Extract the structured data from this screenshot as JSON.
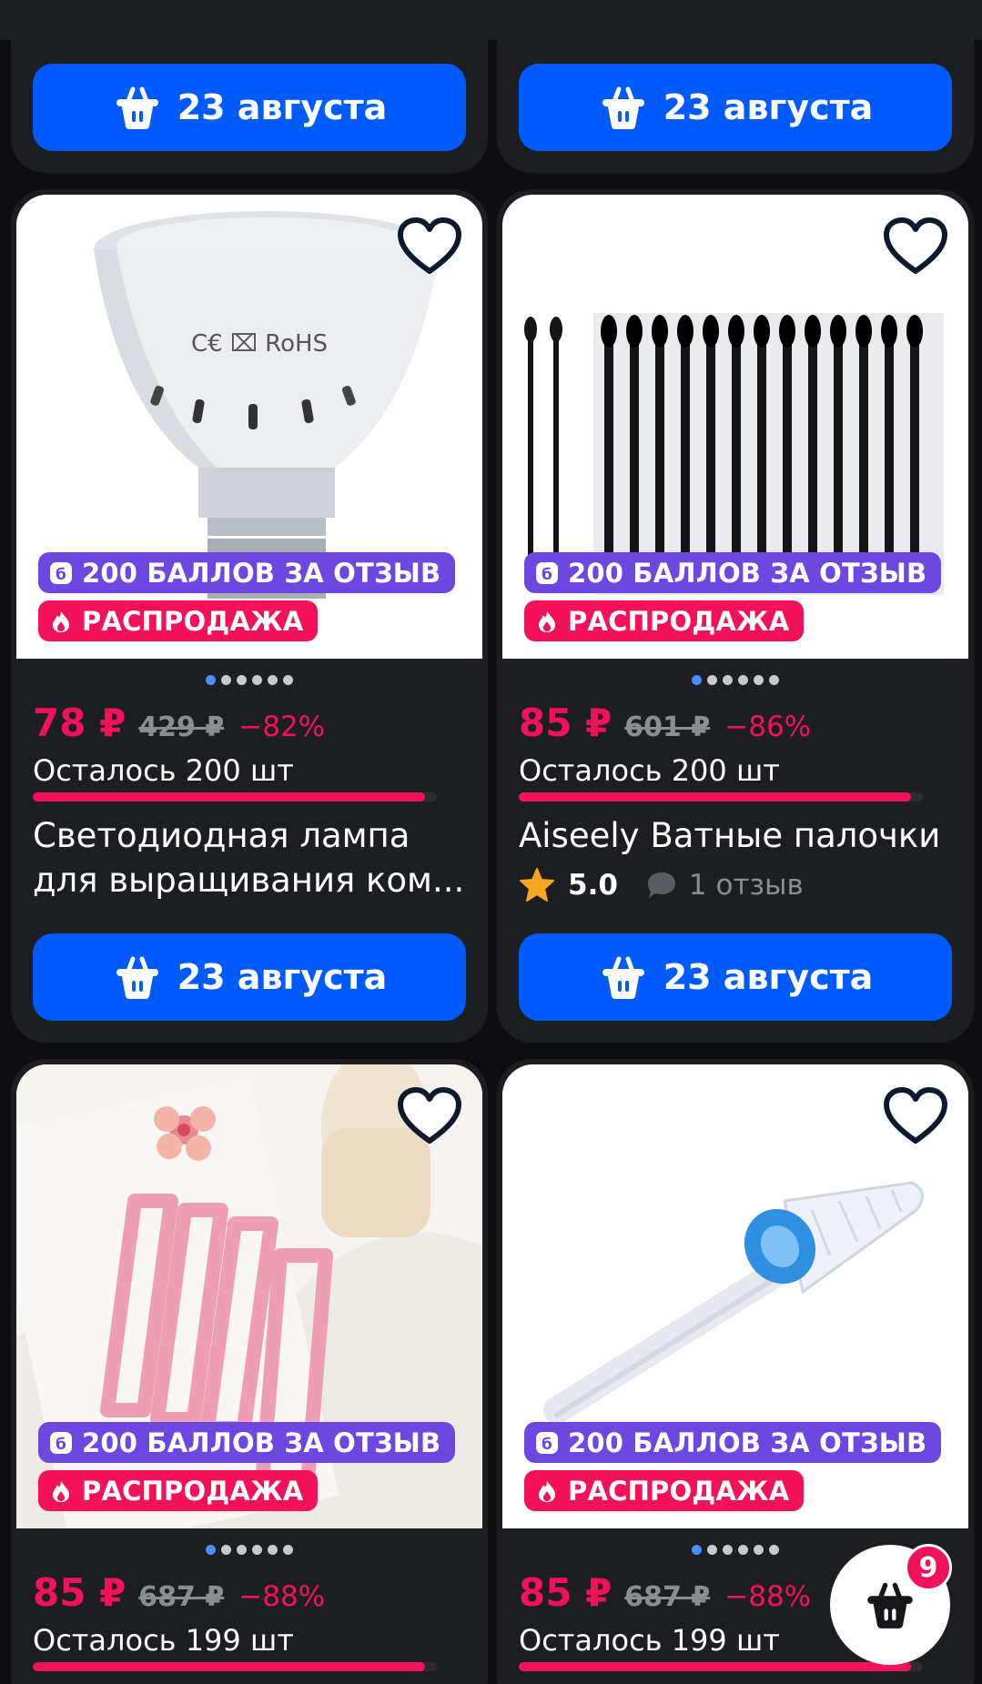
{
  "colors": {
    "accent": "#005bff",
    "sale": "#f3125a",
    "points": "#6c47e0",
    "card": "#1c1e22",
    "background": "#0e0e10"
  },
  "top_cards": [
    {
      "delivery_label": "23 августа"
    },
    {
      "delivery_label": "23 августа"
    }
  ],
  "products": [
    {
      "image": "led-bulb-image",
      "points_badge": "200 БАЛЛОВ ЗА ОТЗЫВ",
      "sale_badge": "РАСПРОДАЖА",
      "price": "78 ₽",
      "old_price": "429 ₽",
      "discount": "−82%",
      "stock": "Осталось 200 шт",
      "stock_fill": 0.97,
      "title": "Светодиодная лампа для выращивания ком...",
      "delivery_label": "23 августа"
    },
    {
      "image": "cotton-swabs-image",
      "points_badge": "200 БАЛЛОВ ЗА ОТЗЫВ",
      "sale_badge": "РАСПРОДАЖА",
      "price": "85 ₽",
      "old_price": "601 ₽",
      "discount": "−86%",
      "stock": "Осталось 200 шт",
      "stock_fill": 0.97,
      "title": "Aiseely Ватные палочки",
      "rating": "5.0",
      "reviews": "1 отзыв",
      "delivery_label": "23 августа"
    },
    {
      "image": "hair-clips-image",
      "points_badge": "200 БАЛЛОВ ЗА ОТЗЫВ",
      "sale_badge": "РАСПРОДАЖА",
      "price": "85 ₽",
      "old_price": "687 ₽",
      "discount": "−88%",
      "stock": "Осталось 199 шт",
      "stock_fill": 0.97
    },
    {
      "image": "nail-drill-bit-image",
      "points_badge": "200 БАЛЛОВ ЗА ОТЗЫВ",
      "sale_badge": "РАСПРОДАЖА",
      "price": "85 ₽",
      "old_price": "687 ₽",
      "discount": "−88%",
      "stock": "Осталось 199 шт",
      "stock_fill": 0.97
    }
  ],
  "cart": {
    "count": "9",
    "icon": "basket-icon"
  },
  "icons": {
    "favorite": "heart-icon",
    "delivery": "basket-icon",
    "points": "points-b-icon",
    "sale": "fire-icon",
    "rating": "star-icon",
    "reviews": "comment-icon"
  }
}
